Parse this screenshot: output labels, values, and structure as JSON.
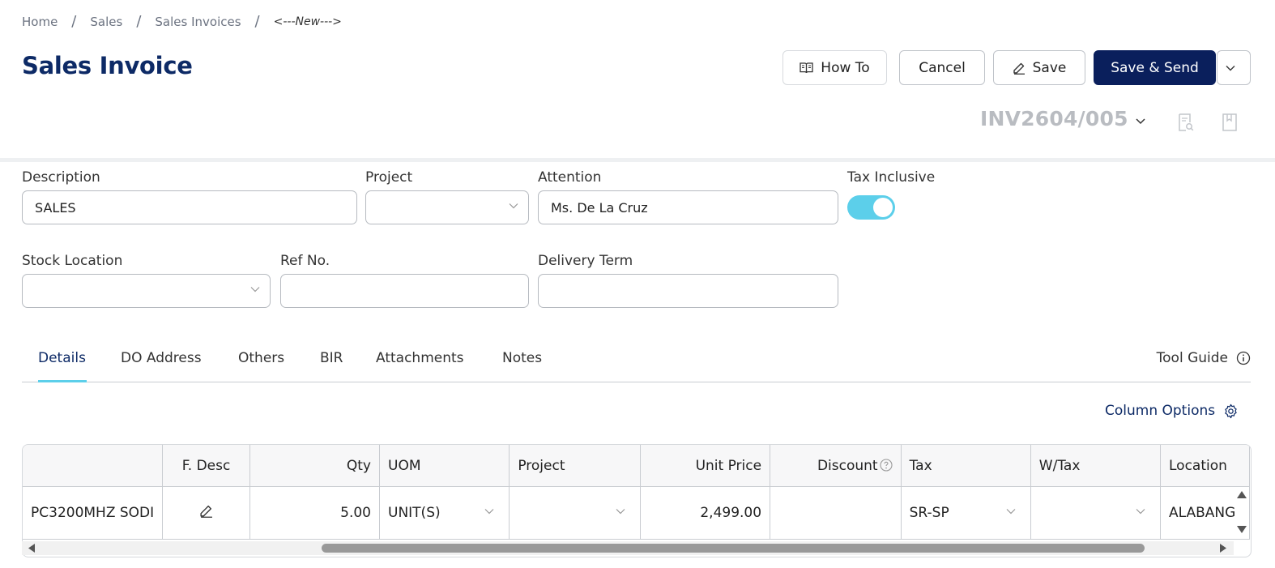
{
  "breadcrumb": {
    "home": "Home",
    "sales": "Sales",
    "invoices": "Sales Invoices",
    "current": "<---New--->"
  },
  "page": {
    "title": "Sales Invoice",
    "doc_no": "INV2604/005"
  },
  "toolbar": {
    "howto_label": "How To",
    "cancel_label": "Cancel",
    "save_label": "Save",
    "send_label": "Save & Send"
  },
  "form": {
    "description_label": "Description",
    "description_value": "SALES",
    "project_label": "Project",
    "project_value": "",
    "attention_label": "Attention",
    "attention_value": "Ms. De La Cruz",
    "tax_inclusive_label": "Tax Inclusive",
    "tax_inclusive_on": true,
    "stock_location_label": "Stock Location",
    "stock_location_value": "",
    "ref_no_label": "Ref No.",
    "ref_no_value": "",
    "delivery_term_label": "Delivery Term",
    "delivery_term_value": ""
  },
  "tabs": {
    "details": "Details",
    "do_address": "DO Address",
    "others": "Others",
    "bir": "BIR",
    "attachments": "Attachments",
    "notes": "Notes",
    "tool_guide": "Tool Guide"
  },
  "column_options_label": "Column Options",
  "grid": {
    "headers": {
      "fdesc": "F. Desc",
      "qty": "Qty",
      "uom": "UOM",
      "project": "Project",
      "unit_price": "Unit Price",
      "discount": "Discount",
      "tax": "Tax",
      "wtax": "W/Tax",
      "location": "Location"
    },
    "rows": [
      {
        "description": "PC3200MHZ SODI",
        "qty": "5.00",
        "uom": "UNIT(S)",
        "project": "",
        "unit_price": "2,499.00",
        "discount": "",
        "tax": "SR-SP",
        "wtax": "",
        "location": "ALABANG"
      }
    ]
  },
  "colors": {
    "brand_navy": "#0a1f5c",
    "accent_cyan": "#5ccfea"
  }
}
